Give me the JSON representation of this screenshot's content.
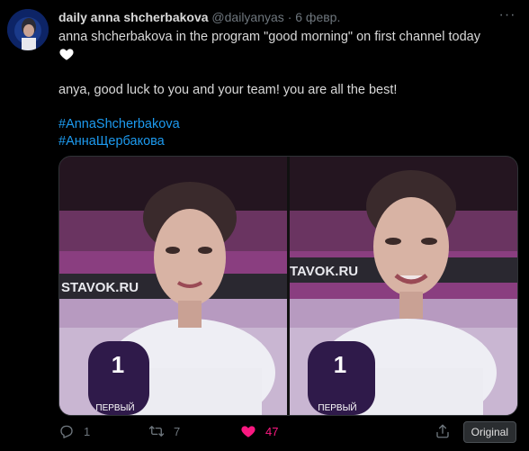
{
  "tweet": {
    "display_name": "daily anna shcherbakova",
    "handle": "@dailyanyas",
    "separator": "·",
    "date": "6 февр.",
    "more_label": "···",
    "text_line1": "anna shcherbakova in the program \"good morning\" on first channel today",
    "text_line2": "anya, good luck to you and your team! you are all the best!",
    "hashtags": [
      "#AnnaShcherbakova",
      "#АннаЩербакова"
    ],
    "replies": "1",
    "retweets": "7",
    "likes": "47",
    "original_label": "Original"
  },
  "media": {
    "photos": [
      {
        "sign_text": "STAVOK.RU",
        "mic_text": "ПЕРВЫЙ"
      },
      {
        "sign_text": "TAVOK.RU",
        "mic_text": "ПЕРВЫЙ"
      }
    ]
  },
  "colors": {
    "background": "#000000",
    "text": "#d9d9d9",
    "muted": "#6e767d",
    "link": "#1d9bf0",
    "like": "#f91880"
  },
  "icons": [
    "reply-icon",
    "retweet-icon",
    "heart-icon",
    "share-icon",
    "more-icon",
    "white-heart-emoji"
  ]
}
